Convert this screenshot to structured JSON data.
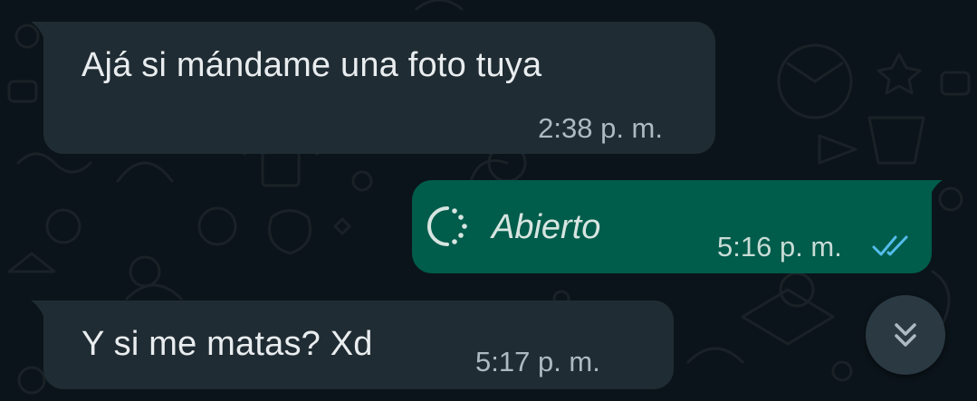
{
  "messages": [
    {
      "direction": "incoming",
      "text": "Ajá si mándame una foto tuya",
      "time": "2:38 p. m."
    },
    {
      "direction": "outgoing",
      "status_icon": "view-once-opened-icon",
      "text": "Abierto",
      "time": "5:16 p. m.",
      "receipt_icon": "double-check-read-icon"
    },
    {
      "direction": "incoming",
      "text": "Y si me matas? Xd",
      "time": "5:17 p. m."
    }
  ],
  "scroll_button": {
    "icon": "double-chevron-down-icon"
  },
  "colors": {
    "background": "#0b141a",
    "incoming_bubble": "#202c33",
    "outgoing_bubble": "#005c4b",
    "read_receipt": "#53bdeb",
    "meta_text": "#aebac1"
  }
}
